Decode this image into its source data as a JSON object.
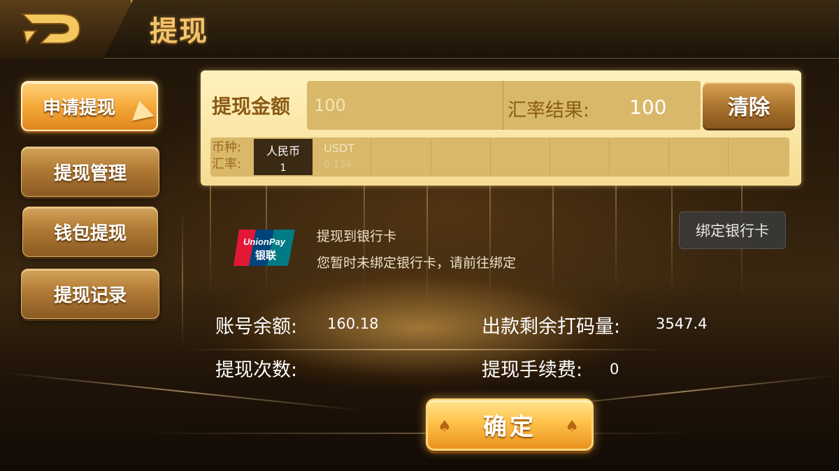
{
  "header": {
    "title": "提现"
  },
  "sidebar": {
    "items": [
      {
        "label": "申请提现",
        "active": true
      },
      {
        "label": "提现管理",
        "active": false
      },
      {
        "label": "钱包提现",
        "active": false
      },
      {
        "label": "提现记录",
        "active": false
      }
    ]
  },
  "withdraw_form": {
    "amount_label": "提现金额",
    "amount_value": "100",
    "rate_result_label": "汇率结果:",
    "rate_result_value": "100",
    "clear_label": "清除",
    "currency_label": "币种:",
    "rate_label": "汇率:",
    "currencies": [
      {
        "name": "人民币",
        "rate": "1",
        "selected": true
      },
      {
        "name": "USDT",
        "rate": "0.134",
        "selected": false
      }
    ]
  },
  "bank": {
    "logo_text_1": "UnionPay",
    "logo_text_2": "银联",
    "title": "提现到银行卡",
    "subtitle": "您暂时未绑定银行卡，请前往绑定",
    "bind_label": "绑定银行卡"
  },
  "info": {
    "balance_label": "账号余额:",
    "balance_value": "160.18",
    "turnover_label": "出款剩余打码量:",
    "turnover_value": "3547.4",
    "count_label": "提现次数:",
    "count_value": "",
    "fee_label": "提现手续费:",
    "fee_value": "0"
  },
  "confirm_label": "确定",
  "colors": {
    "gold_title": "#f3c36b",
    "panel_bg": "#f6dc92",
    "active_tab": "#f5a93a",
    "currency_selected": "#3a2a14"
  }
}
